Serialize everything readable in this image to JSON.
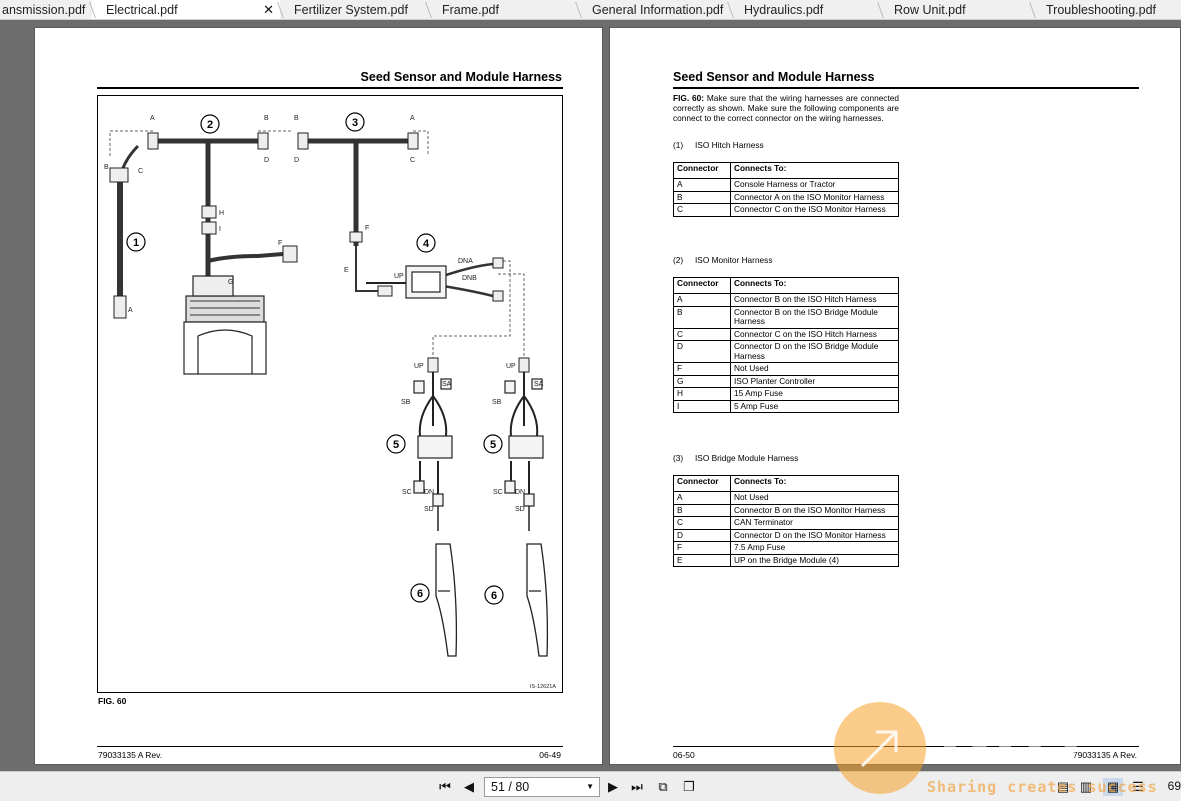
{
  "tabs": [
    {
      "label": "ansmission.pdf",
      "active": false
    },
    {
      "label": "Electrical.pdf",
      "active": true
    },
    {
      "label": "Fertilizer System.pdf",
      "active": false
    },
    {
      "label": "Frame.pdf",
      "active": false
    },
    {
      "label": "General Information.pdf",
      "active": false
    },
    {
      "label": "Hydraulics.pdf",
      "active": false
    },
    {
      "label": "Row Unit.pdf",
      "active": false
    },
    {
      "label": "Troubleshooting.pdf",
      "active": false
    }
  ],
  "left_page": {
    "title": "Seed Sensor and Module Harness",
    "figure_label": "FIG. 60",
    "figure_id": "IS-12621A",
    "footer_left": "79033135 A Rev.",
    "footer_right": "06-49",
    "diagram": {
      "callouts": [
        "1",
        "2",
        "3",
        "4",
        "5",
        "5",
        "6",
        "6"
      ],
      "connector_letters": {
        "a1": "A",
        "b1": "B",
        "c1": "C",
        "a2": "A",
        "b2": "B",
        "d2": "D",
        "b3": "B",
        "d3": "D",
        "a3": "A",
        "c3": "C",
        "h": "H",
        "i": "I",
        "f1": "F",
        "g": "G",
        "f2": "F",
        "e": "E",
        "up": "UP",
        "dna": "DNA",
        "dnb": "DNB",
        "up_l": "UP",
        "sa_l": "SA",
        "sb_l": "SB",
        "sc_l": "SC",
        "dn_l": "DN",
        "sd_l": "SD",
        "up_r": "UP",
        "sa_r": "SA",
        "sb_r": "SB",
        "sc_r": "SC",
        "dn_r": "DN",
        "sd_r": "SD"
      }
    }
  },
  "right_page": {
    "title": "Seed Sensor and Module Harness",
    "fig_ref": "FIG. 60:",
    "paragraph": "Make sure that the wiring harnesses are connected correctly as shown. Make sure the following components are connect to the correct connector on the wiring harnesses.",
    "footer_left": "06-50",
    "footer_right": "79033135 A Rev.",
    "sections": [
      {
        "number": "(1)",
        "title": "ISO Hitch Harness",
        "header": [
          "Connector",
          "Connects To:"
        ],
        "rows": [
          [
            "A",
            "Console Harness or Tractor"
          ],
          [
            "B",
            "Connector A on the ISO Monitor Harness"
          ],
          [
            "C",
            "Connector C on the ISO Monitor Harness"
          ]
        ]
      },
      {
        "number": "(2)",
        "title": "ISO Monitor Harness",
        "header": [
          "Connector",
          "Connects To:"
        ],
        "rows": [
          [
            "A",
            "Connector B on the ISO Hitch Harness"
          ],
          [
            "B",
            "Connector B on the ISO Bridge Module Harness"
          ],
          [
            "C",
            "Connector C on the ISO Hitch Harness"
          ],
          [
            "D",
            "Connector D on the ISO Bridge Module Harness"
          ],
          [
            "F",
            "Not Used"
          ],
          [
            "G",
            "ISO Planter Controller"
          ],
          [
            "H",
            "15 Amp Fuse"
          ],
          [
            "I",
            "5 Amp Fuse"
          ]
        ]
      },
      {
        "number": "(3)",
        "title": "ISO Bridge Module Harness",
        "header": [
          "Connector",
          "Connects To:"
        ],
        "rows": [
          [
            "A",
            "Not Used"
          ],
          [
            "B",
            "Connector B on the ISO Monitor Harness"
          ],
          [
            "C",
            "CAN Terminator"
          ],
          [
            "D",
            "Connector D on the ISO Monitor Harness"
          ],
          [
            "F",
            "7.5 Amp Fuse"
          ],
          [
            "E",
            "UP on the Bridge Module (4)"
          ]
        ]
      }
    ]
  },
  "toolbar": {
    "page_value": "51 / 80",
    "zoom_partial": "69"
  },
  "watermark": {
    "logo": "DHT",
    "tagline": "Sharing creates success"
  }
}
